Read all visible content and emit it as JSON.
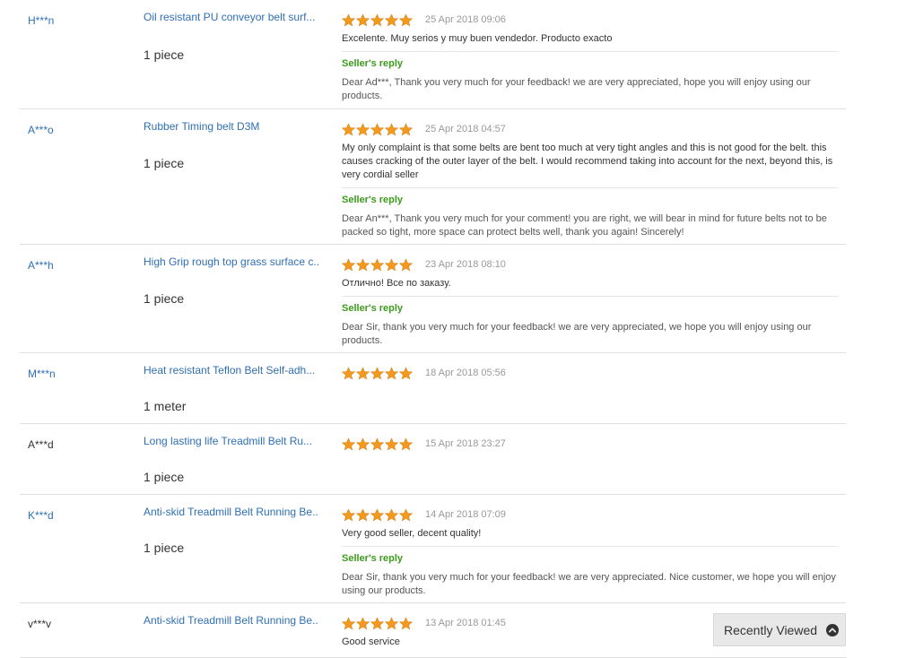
{
  "feedback": [
    {
      "buyer": "H***n",
      "product": "Oil resistant PU conveyor belt surf...",
      "quantity": "1 piece",
      "stars": 5,
      "date": "25 Apr 2018 09:06",
      "comment": "Excelente. Muy serios y muy buen vendedor. Producto exacto",
      "reply_title": "Seller's reply",
      "reply": "Dear Ad***, Thank you very much for your feedback! we are very appreciated, hope you will enjoy using our products."
    },
    {
      "buyer": "A***o",
      "product": "Rubber Timing belt D3M",
      "quantity": "1 piece",
      "stars": 5,
      "date": "25 Apr 2018 04:57",
      "comment": "My only complaint is that some belts are bent too much at very tight angles and this is not good for the belt. this causes cracking of the outer layer of the belt. I would recommend taking into account for the next, beyond this, is very cordial seller",
      "reply_title": "Seller's reply",
      "reply": "Dear An***, Thank you very much for your comment! you are right, we will bear in mind for future belts not to be packed so tight, more space can protect belts well, thank you again! Sincerely!"
    },
    {
      "buyer": "A***h",
      "product": "High Grip rough top grass surface c...",
      "quantity": "1 piece",
      "stars": 5,
      "date": "23 Apr 2018 08:10",
      "comment": "Отлично! Все по заказу.",
      "reply_title": "Seller's reply",
      "reply": "Dear Sir, thank you very much for your feedback! we are very appreciated, we hope you will enjoy using our products."
    },
    {
      "buyer": "M***n",
      "product": "Heat resistant Teflon Belt Self-adh...",
      "quantity": "1 meter",
      "stars": 5,
      "date": "18 Apr 2018 05:56"
    },
    {
      "buyer": "A***d",
      "product": "Long lasting life Treadmill Belt Ru...",
      "quantity": "1 piece",
      "stars": 5,
      "date": "15 Apr 2018 23:27"
    },
    {
      "buyer": "K***d",
      "product": "Anti-skid Treadmill Belt Running Be...",
      "quantity": "1 piece",
      "stars": 5,
      "date": "14 Apr 2018 07:09",
      "comment": "Very good seller, decent quality!",
      "reply_title": "Seller's reply",
      "reply": "Dear Sir, thank you very much for your feedback! we are very appreciated. Nice customer, we hope you will enjoy using our products."
    },
    {
      "buyer": "v***v",
      "product": "Anti-skid Treadmill Belt Running Be...",
      "stars": 5,
      "date": "13 Apr 2018 01:45",
      "comment": "Good service"
    }
  ],
  "recently_viewed": {
    "label": "Recently Viewed",
    "icon": "chevron-up-circle-icon"
  },
  "colors": {
    "link": "#2f6fb4",
    "star_fill": "#f39a1c",
    "reply_green": "#3c9b1d",
    "date_gray": "#999999",
    "divider": "#e0e0e0"
  }
}
